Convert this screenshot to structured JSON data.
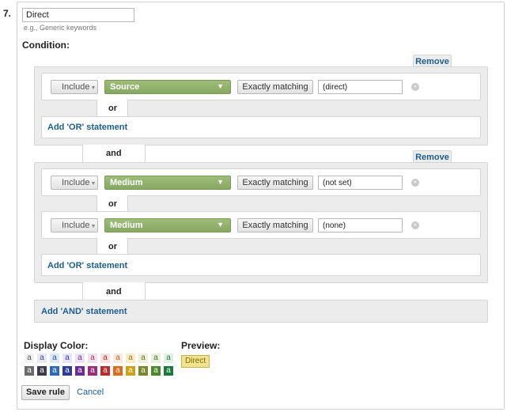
{
  "rule": {
    "number": "7.",
    "name_value": "Direct",
    "name_hint": "e.g., Generic keywords",
    "condition_label": "Condition:"
  },
  "groups": [
    {
      "remove_label": "Remove",
      "rows": [
        {
          "include": "Include",
          "dimension": "Source",
          "match": "Exactly matching",
          "value": "(direct)"
        }
      ],
      "or_label": "or",
      "add_or_label": "Add 'OR' statement"
    },
    {
      "remove_label": "Remove",
      "rows": [
        {
          "include": "Include",
          "dimension": "Medium",
          "match": "Exactly matching",
          "value": "(not set)"
        },
        {
          "include": "Include",
          "dimension": "Medium",
          "match": "Exactly matching",
          "value": "(none)"
        }
      ],
      "or_label": "or",
      "add_or_label": "Add 'OR' statement"
    }
  ],
  "and_label": "and",
  "add_and_label": "Add 'AND' statement",
  "display_color": {
    "label": "Display Color:",
    "swatch_letter": "a",
    "top_row": [
      {
        "bg": "#f2f2f2",
        "fg": "#555555"
      },
      {
        "bg": "#e8e8f4",
        "fg": "#4a4a8a"
      },
      {
        "bg": "#dfe8f7",
        "fg": "#2a5aa0"
      },
      {
        "bg": "#e4e4fa",
        "fg": "#3a3ac0"
      },
      {
        "bg": "#ece0f4",
        "fg": "#6a3a90"
      },
      {
        "bg": "#f4e0ec",
        "fg": "#a03a70"
      },
      {
        "bg": "#f7e0e0",
        "fg": "#b03030"
      },
      {
        "bg": "#faeadc",
        "fg": "#c0602a"
      },
      {
        "bg": "#f7ecc8",
        "fg": "#a07a10"
      },
      {
        "bg": "#eef0d8",
        "fg": "#6a7a20"
      },
      {
        "bg": "#e6f0dc",
        "fg": "#4a7a2a"
      },
      {
        "bg": "#e0f0e4",
        "fg": "#2a7a4a"
      }
    ],
    "bottom_row": [
      {
        "bg": "#6a6a6a",
        "fg": "#ffffff"
      },
      {
        "bg": "#3a3a4a",
        "fg": "#ffffff"
      },
      {
        "bg": "#2a6ac0",
        "fg": "#ffffff"
      },
      {
        "bg": "#2a3aa0",
        "fg": "#ffffff"
      },
      {
        "bg": "#6a2a9a",
        "fg": "#ffffff"
      },
      {
        "bg": "#a02a7a",
        "fg": "#ffffff"
      },
      {
        "bg": "#c02a2a",
        "fg": "#ffffff"
      },
      {
        "bg": "#e06a1a",
        "fg": "#ffffff"
      },
      {
        "bg": "#d0a010",
        "fg": "#ffffff"
      },
      {
        "bg": "#7a8a2a",
        "fg": "#ffffff"
      },
      {
        "bg": "#4a8a2a",
        "fg": "#ffffff"
      },
      {
        "bg": "#1a7a3a",
        "fg": "#ffffff"
      }
    ]
  },
  "preview": {
    "label": "Preview:",
    "chip_text": "Direct"
  },
  "actions": {
    "save_label": "Save rule",
    "cancel_label": "Cancel"
  },
  "icons": {
    "clear": "clear-circle-icon",
    "dropdown": "dropdown-triangle-icon",
    "caret": "caret-down-icon"
  }
}
